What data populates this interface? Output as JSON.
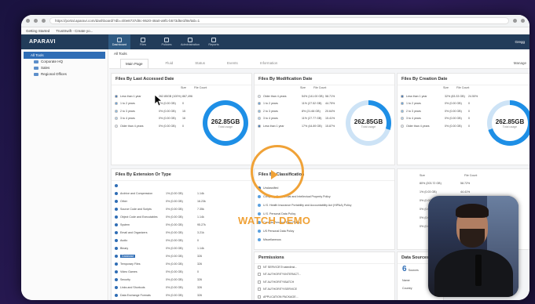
{
  "browser": {
    "url": "https://portal.aparavi.com/dashboard/?db=4/0e8737d0c-9520-48a0-a9f1-b573d5e1f8e/tab=1",
    "bookmarks": [
      "Getting Started",
      "TrustSwift - Create yo..."
    ]
  },
  "app": {
    "logo": "APARAVI",
    "nav": [
      {
        "label": "Dashboard",
        "icon": "dashboard-icon",
        "active": true
      },
      {
        "label": "Files",
        "icon": "files-icon",
        "active": false
      },
      {
        "label": "Policies",
        "icon": "policies-icon",
        "active": false
      },
      {
        "label": "Administration",
        "icon": "admin-icon",
        "active": false
      },
      {
        "label": "Reports",
        "icon": "reports-icon",
        "active": false
      }
    ],
    "user": "Gregg"
  },
  "sidebar": {
    "root": "All Tools",
    "items": [
      "Corporate HQ",
      "Sales",
      "Regional Offices"
    ]
  },
  "breadcrumb": "All Tools",
  "tabs": [
    "Main Page",
    "Fluid",
    "Status",
    "Events",
    "Information"
  ],
  "manage_label": "Manage",
  "panels": {
    "last_accessed": {
      "title": "Files By Last Accessed Date",
      "col_size": "Size",
      "col_count": "File Count",
      "rows": [
        {
          "label": "Less than 1 year",
          "size": "262.85GB (100%)",
          "count": "867,496",
          "color": "#2f6db5"
        },
        {
          "label": "1 to 2 years",
          "size": "0% (0.00 GB)",
          "count": "0",
          "color": "#5aa0e0"
        },
        {
          "label": "2 to 3 years",
          "size": "0% (0.00 GB)",
          "count": "15",
          "color": "#85bde9"
        },
        {
          "label": "3 to 4 years",
          "size": "0% (0.00 GB)",
          "count": "16",
          "color": "#b5d6f2"
        },
        {
          "label": "Older than 4 years",
          "size": "0% (0.00 GB)",
          "count": "0",
          "color": "#e6eef8"
        }
      ],
      "total": "262.85GB",
      "total_label": "Total usage",
      "ring_pct": 100
    },
    "modification": {
      "title": "Files By Modification Date",
      "col_size": "Size",
      "col_count": "File Count",
      "rows": [
        {
          "label": "Older than 4 years",
          "size": "54% (141.00 GB)",
          "count": "58.71%",
          "color": "#e6eef8"
        },
        {
          "label": "1 to 2 years",
          "size": "11% (27.52 GB)",
          "count": "44.75%",
          "color": "#5aa0e0"
        },
        {
          "label": "2 to 3 years",
          "size": "8% (21.66 GB)",
          "count": "20.64%",
          "color": "#85bde9"
        },
        {
          "label": "3 to 4 years",
          "size": "11% (27.77 GB)",
          "count": "15.41%",
          "color": "#b5d6f2"
        },
        {
          "label": "Less than 1 year",
          "size": "17% (44.89 GB)",
          "count": "15.87%",
          "color": "#2f6db5"
        }
      ],
      "total": "262.85GB",
      "total_label": "Total usage",
      "ring_pct": 30
    },
    "creation": {
      "title": "Files By Creation Date",
      "col_size": "Size",
      "col_count": "File Count",
      "rows": [
        {
          "label": "Less than 1 year",
          "size": "32% (83.33 GB)",
          "count": "24.50%",
          "color": "#2f6db5"
        },
        {
          "label": "1 to 2 years",
          "size": "0% (0.00 GB)",
          "count": "0",
          "color": "#5aa0e0"
        },
        {
          "label": "2 to 3 years",
          "size": "0% (0.00 GB)",
          "count": "0",
          "color": "#85bde9"
        },
        {
          "label": "3 to 4 years",
          "size": "0% (0.00 GB)",
          "count": "0",
          "color": "#b5d6f2"
        },
        {
          "label": "Older than 4 years",
          "size": "0% (0.00 GB)",
          "count": "0",
          "color": "#e6eef8"
        }
      ],
      "total": "262.85GB",
      "total_label": "Total usage",
      "ring_pct": 70
    },
    "extension": {
      "title": "Files By Extension Or Type",
      "rows": [
        {
          "name": "",
          "size": "",
          "count": ""
        },
        {
          "name": "Archive and Compression",
          "size": "1% (0.00 GB)",
          "count": "1.14k"
        },
        {
          "name": "Other",
          "size": "0% (0.00 GB)",
          "count": "16.23k"
        },
        {
          "name": "Source Code and Scripts",
          "size": "0% (0.00 GB)",
          "count": "7.35k"
        },
        {
          "name": "Object Code and Executables",
          "size": "0% (0.00 GB)",
          "count": "1.14k"
        },
        {
          "name": "System",
          "size": "0% (0.00 GB)",
          "count": "95.27k"
        },
        {
          "name": "Email and Organizers",
          "size": "0% (0.00 GB)",
          "count": "3.21k"
        },
        {
          "name": "Audio",
          "size": "0% (0.00 GB)",
          "count": "0"
        },
        {
          "name": "Binary",
          "size": "0% (0.00 GB)",
          "count": "1.14k"
        },
        {
          "name": "Database",
          "size": "0% (0.00 GB)",
          "count": "326"
        },
        {
          "name": "Temporary Files",
          "size": "0% (0.00 GB)",
          "count": "326"
        },
        {
          "name": "Video Games",
          "size": "0% (0.00 GB)",
          "count": "0"
        },
        {
          "name": "Security",
          "size": "0% (0.00 GB)",
          "count": "326"
        },
        {
          "name": "Links and Shortcuts",
          "size": "0% (0.00 GB)",
          "count": "326"
        },
        {
          "name": "Data Exchange Formats",
          "size": "0% (0.00 GB)",
          "count": "326"
        }
      ]
    },
    "classification": {
      "title": "Files By Classification",
      "rows": [
        "Unclassified",
        "Company Confidential and Intellectual Property Policy",
        "U.S. Health Insurance Portability and Accountability Act (HIPAA) Policy",
        "U.S. Personal Data Policy",
        "Canada Personal Data Policy",
        "US Personal Data Policy",
        "Miscellaneous"
      ]
    },
    "right_table": {
      "col_size": "Size",
      "col_count": "File Count",
      "rows": [
        {
          "size": "80% (203.72 GB)",
          "count": "58.72%"
        },
        {
          "size": "1% (0.03 GB)",
          "count": "44.41%"
        },
        {
          "size": "0% (0.00 GB)",
          "count": ""
        },
        {
          "size": "0% (0.00 GB)",
          "count": ""
        },
        {
          "size": "0% (0.00 GB)",
          "count": ""
        },
        {
          "size": "0% (0.00 GB)",
          "count": ""
        }
      ]
    },
    "permissions": {
      "title": "Permissions",
      "rows": [
        "NT SERVICE\\TrustedInst...",
        "NT AUTHORITY\\INTERACT...",
        "NT AUTHORITY\\BATCH",
        "NT AUTHORITY\\SERVICE",
        "APPLICATION PACKAGE..."
      ]
    },
    "data_sources": {
      "title": "Data Sources",
      "count": "6",
      "sub": "Sources",
      "labels": [
        "Name",
        "Country"
      ]
    }
  },
  "overlay": {
    "watch_demo": "WATCH DEMO",
    "accent": "#f0a237"
  }
}
